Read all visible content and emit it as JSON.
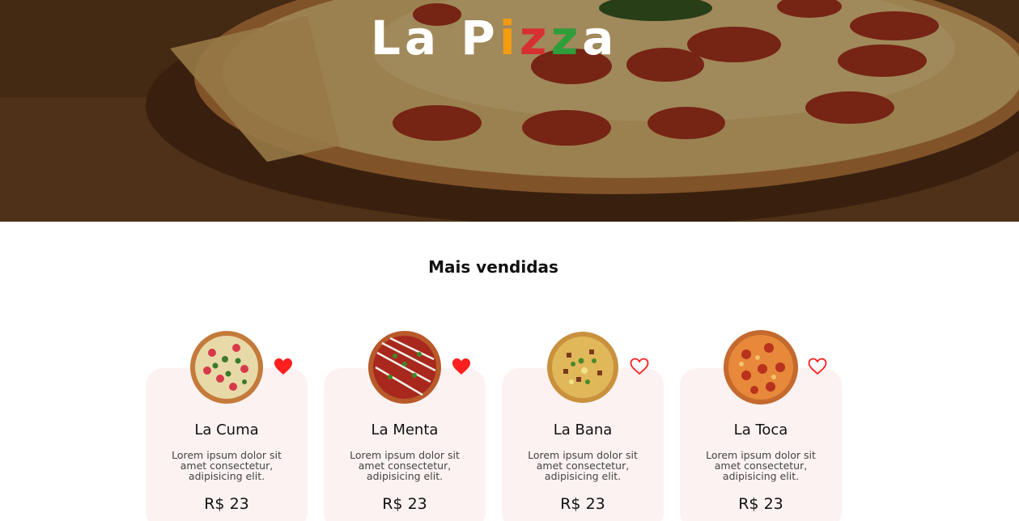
{
  "brand": {
    "letters": [
      "La P",
      "i",
      "z",
      "z",
      "a"
    ],
    "colors": {
      "white": "#ffffff",
      "orange": "#f39c12",
      "red": "#d63031",
      "green": "#2e9d3a"
    }
  },
  "section": {
    "title": "Mais vendidas"
  },
  "products": [
    {
      "name": "La Cuma",
      "description": "Lorem ipsum dolor sit amet consectetur, adipisicing elit.",
      "price": "R$ 23",
      "favorite": true,
      "icon": "heart-filled-icon"
    },
    {
      "name": "La Menta",
      "description": "Lorem ipsum dolor sit amet consectetur, adipisicing elit.",
      "price": "R$ 23",
      "favorite": true,
      "icon": "heart-filled-icon"
    },
    {
      "name": "La Bana",
      "description": "Lorem ipsum dolor sit amet consectetur, adipisicing elit.",
      "price": "R$ 23",
      "favorite": false,
      "icon": "heart-outline-icon"
    },
    {
      "name": "La Toca",
      "description": "Lorem ipsum dolor sit amet consectetur, adipisicing elit.",
      "price": "R$ 23",
      "favorite": false,
      "icon": "heart-outline-icon"
    }
  ],
  "colors": {
    "heart": "#ff1f1f",
    "card_bg": "#fdf2f2"
  }
}
